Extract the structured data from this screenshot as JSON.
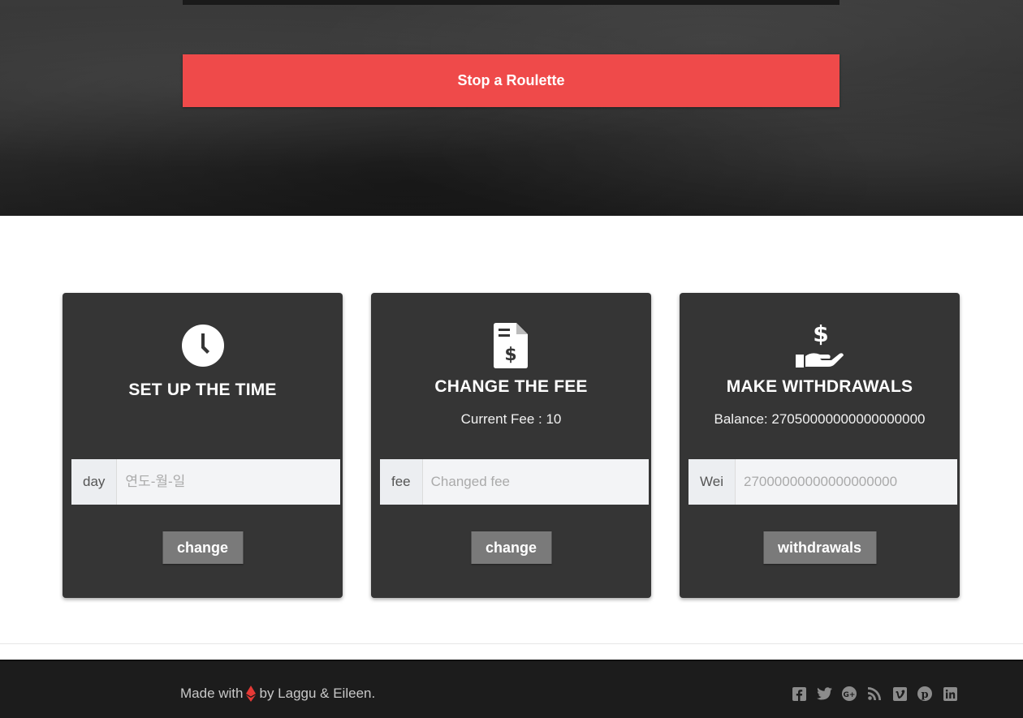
{
  "hero": {
    "stop_label": "Stop a Roulette"
  },
  "cards": {
    "time": {
      "icon": "clock-icon",
      "title": "SET UP THE TIME",
      "addon": "day",
      "placeholder": "연도-월-일",
      "button": "change"
    },
    "fee": {
      "icon": "invoice-dollar-icon",
      "title": "CHANGE THE FEE",
      "info": "Current Fee : 10",
      "addon": "fee",
      "placeholder": "Changed fee",
      "button": "change"
    },
    "withdraw": {
      "icon": "hand-dollar-icon",
      "title": "MAKE WITHDRAWALS",
      "info": "Balance: 27050000000000000000",
      "addon": "Wei",
      "placeholder": "27000000000000000000",
      "button": "withdrawals"
    }
  },
  "footer": {
    "prefix": "Made with",
    "suffix": "by Laggu & Eileen.",
    "heart_icon": "ethereum-icon",
    "heart_color": "#e53935",
    "social": [
      "facebook-icon",
      "twitter-icon",
      "google-plus-icon",
      "rss-icon",
      "vimeo-icon",
      "pinterest-icon",
      "linkedin-icon"
    ]
  },
  "colors": {
    "accent": "#ef4a4a",
    "card_bg": "#353535",
    "button_bg": "#7a7a7a",
    "footer_bg": "#1c1c1c"
  }
}
